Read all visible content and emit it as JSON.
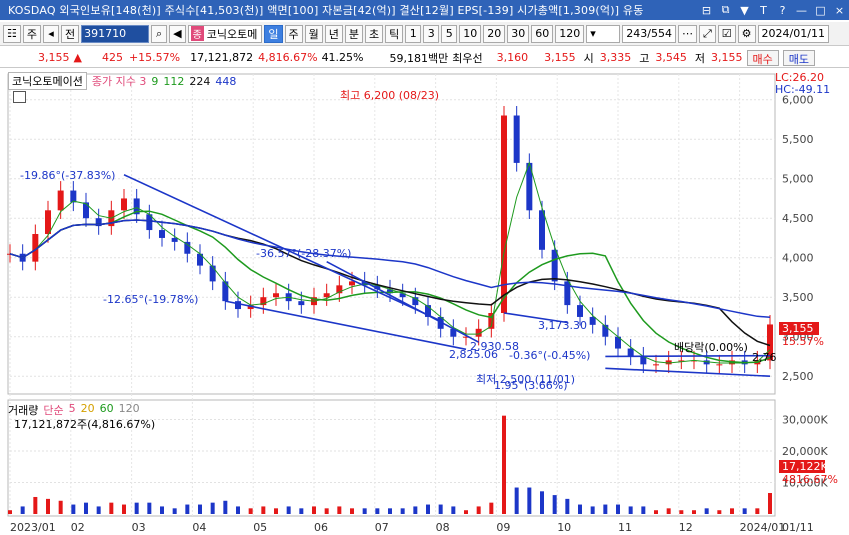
{
  "window": {
    "title": "KOSDAQ 외국인보유[148(천)] 주식수[41,503(천)] 액면[100] 자본금[42(억)] 결산[12월] EPS[-139] 시가총액[1,309(억)] 유동",
    "controls": [
      "⊟",
      "⧉",
      "▼",
      "T",
      "?",
      "—",
      "□",
      "×"
    ]
  },
  "toolbar": {
    "view_label": "주",
    "period_label": "전",
    "stock_code": "391710",
    "badge": "종",
    "stock_name": "코닉오토메",
    "tabs": [
      "일",
      "주",
      "월",
      "년",
      "분",
      "초",
      "틱"
    ],
    "selected_tab": "일",
    "intervals": [
      "1",
      "3",
      "5",
      "10",
      "20",
      "30",
      "60",
      "120"
    ],
    "page_counter": "243/554",
    "date": "2024/01/11"
  },
  "price": {
    "last": "3,155",
    "arrow": "▲",
    "change": "425",
    "change_pct": "+15.57%",
    "volume": "17,121,872",
    "volume_pct": "4,816.67%",
    "ratio": "41.25%",
    "amount": "59,181백만",
    "best_ask_label": "최우선",
    "best_ask": "3,160",
    "best_bid": "3,155",
    "open_label": "시",
    "open": "3,335",
    "high_label": "고",
    "high": "3,545",
    "low_label": "저",
    "low": "3,155",
    "buy_label": "매수",
    "sell_label": "매도"
  },
  "legend": {
    "name": "코닉오토메이션",
    "title": "종가 지수 3",
    "ma_periods": [
      "9",
      "112",
      "224",
      "448"
    ],
    "ma_colors": [
      "#1e9a1e",
      "#1e9a1e",
      "#111111",
      "#1c36c8"
    ]
  },
  "right_info": {
    "lc": "LC:26.20",
    "hc": "HC:-49.11",
    "current": "3,155",
    "current_pct": "15.57%",
    "volume_current": "17,122K",
    "volume_pct": "4816.67%"
  },
  "annotations": {
    "high": "최고 6,200 (08/23)",
    "low": "최저 2,500 (11/01)",
    "dividend": "배당락(0.00%)",
    "t1": "-19.86°(-37.83%)",
    "t2": "-12.65°(-19.78%)",
    "t3": "-36.57°(-28.37%)",
    "t4": "-0.36°(-0.45%)",
    "t5": "1.95°(3.66%)",
    "p1": "2,930.58",
    "p2": "2,825.06",
    "p3": "3,173.30",
    "p4": "2,76"
  },
  "volume_legend": {
    "title": "거래량",
    "simple": "단순",
    "periods": [
      "5",
      "20",
      "60",
      "120"
    ],
    "summary": "17,121,872주(4,816.67%)"
  },
  "chart_data": {
    "type": "candlestick",
    "y_axis": {
      "range": [
        2300,
        6300
      ],
      "ticks": [
        "2,500",
        "3,000",
        "3,500",
        "4,000",
        "4,500",
        "5,000",
        "5,500",
        "6,000"
      ]
    },
    "volume_axis": {
      "ticks": [
        "10,000K",
        "20,000K",
        "30,000K"
      ]
    },
    "x_ticks": [
      "2023/01",
      "02",
      "03",
      "04",
      "05",
      "06",
      "07",
      "08",
      "09",
      "10",
      "11",
      "12",
      "2024/01",
      "01/11"
    ],
    "close_series": [
      4050,
      3950,
      4300,
      4600,
      4850,
      4700,
      4500,
      4400,
      4600,
      4750,
      4550,
      4350,
      4250,
      4200,
      4050,
      3900,
      3700,
      3450,
      3350,
      3400,
      3500,
      3550,
      3450,
      3400,
      3500,
      3550,
      3650,
      3700,
      3650,
      3600,
      3550,
      3500,
      3400,
      3250,
      3100,
      3000,
      3000,
      3100,
      3300,
      5800,
      5200,
      4600,
      4100,
      3700,
      3400,
      3250,
      3150,
      3000,
      2850,
      2750,
      2650,
      2650,
      2700,
      2700,
      2700,
      2650,
      2650,
      2700,
      2650,
      2700,
      3155
    ]
  }
}
